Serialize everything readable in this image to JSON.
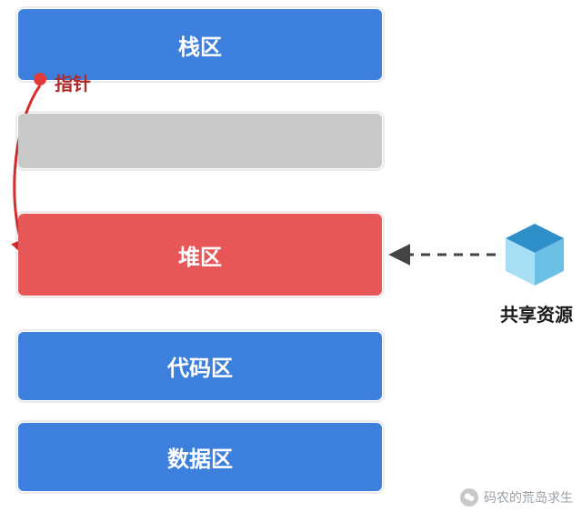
{
  "segments": {
    "stack": {
      "label": "栈区",
      "color": "#3d7fdc"
    },
    "gap": {
      "label": "",
      "color": "#c9c9c9"
    },
    "heap": {
      "label": "堆区",
      "color": "#e85757"
    },
    "code": {
      "label": "代码区",
      "color": "#3d7fdc"
    },
    "data": {
      "label": "数据区",
      "color": "#3d7fdc"
    }
  },
  "pointer": {
    "label": "指针"
  },
  "resource": {
    "label": "共享资源",
    "cube_color": "#4aa3d8"
  },
  "watermark": {
    "text": "码农的荒岛求生"
  }
}
